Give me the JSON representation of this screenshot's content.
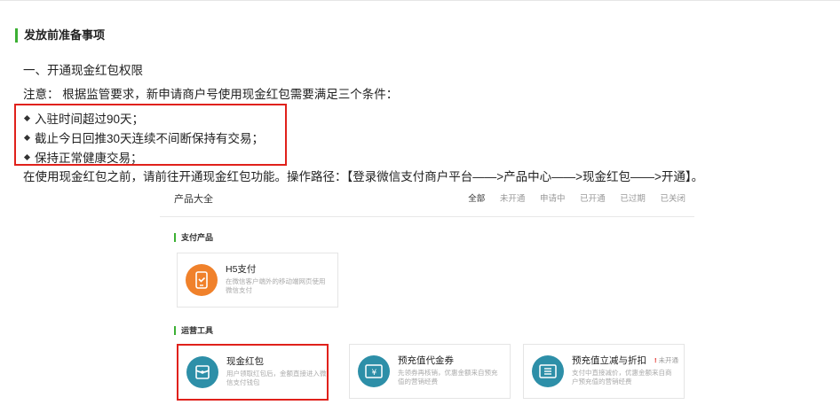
{
  "section_title": "发放前准备事项",
  "heading": "一、开通现金红包权限",
  "notice": "注意： 根据监管要求，新申请商户号使用现金红包需要满足三个条件：",
  "conditions": [
    "入驻时间超过90天；",
    "截止今日回推30天连续不间断保持有交易；",
    "保持正常健康交易；"
  ],
  "path_text": "在使用现金红包之前，请前往开通现金红包功能。操作路径：【登录微信支付商户平台——>产品中心——>现金红包——>开通】。",
  "products": {
    "title": "产品大全",
    "filters": [
      "全部",
      "未开通",
      "申请中",
      "已开通",
      "已过期",
      "已关闭"
    ],
    "pay_section": "支付产品",
    "ops_section": "运营工具",
    "cards": {
      "h5": {
        "title": "H5支付",
        "desc": "在微信客户端外的移动端网页使用微信支付",
        "icon": "phone-pay-icon"
      },
      "hongbao": {
        "title": "现金红包",
        "desc": "用户领取红包后，金额直接进入微信支付钱包",
        "icon": "red-packet-icon"
      },
      "voucher": {
        "title": "预充值代金券",
        "desc": "先领券再核销，优惠金额来自预充值的营销经费",
        "icon": "voucher-icon"
      },
      "discount": {
        "title": "预充值立减与折扣",
        "desc": "支付中直接减价，优惠金额来自商户预充值的营销经费",
        "icon": "discount-icon",
        "status": "未开通"
      }
    }
  },
  "colors": {
    "accent_green": "#3cb034",
    "highlight_red": "#e0211b",
    "icon_orange": "#f0812b",
    "icon_teal": "#2d8fa8"
  }
}
